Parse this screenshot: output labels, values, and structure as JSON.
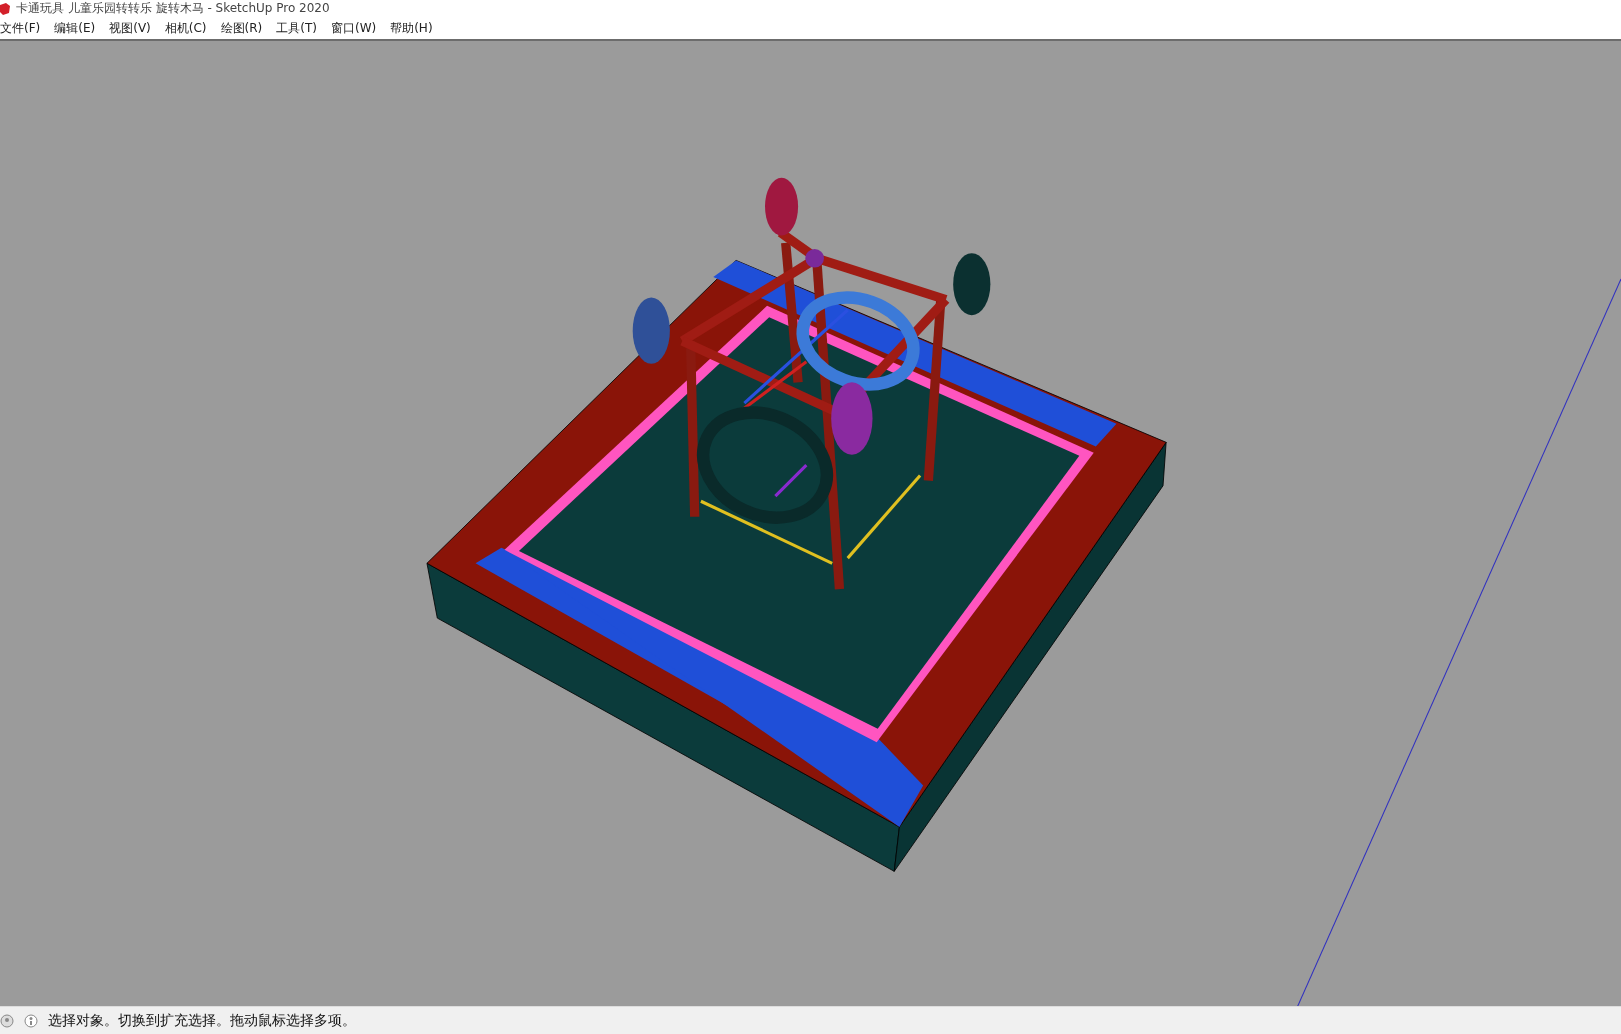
{
  "window": {
    "title": "卡通玩具 儿童乐园转转乐 旋转木马 - SketchUp Pro 2020"
  },
  "menu": [
    "文件(F)",
    "编辑(E)",
    "视图(V)",
    "相机(C)",
    "绘图(R)",
    "工具(T)",
    "窗口(W)",
    "帮助(H)"
  ],
  "status_bar": {
    "message": "选择对象。切换到扩充选择。拖动鼠标选择多项。"
  }
}
